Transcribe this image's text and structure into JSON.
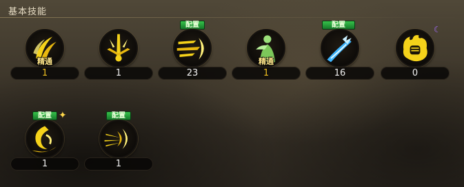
{
  "panel": {
    "title": "基本技能"
  },
  "skills": [
    {
      "icon": "golden-slash-icon",
      "level": "1",
      "level_color": "gold",
      "tag": "",
      "mastery": "精通"
    },
    {
      "icon": "golden-burst-icon",
      "level": "1",
      "level_color": "white",
      "tag": "",
      "mastery": ""
    },
    {
      "icon": "golden-rush-icon",
      "level": "23",
      "level_color": "white",
      "tag": "配置",
      "mastery": ""
    },
    {
      "icon": "green-figure-icon",
      "level": "1",
      "level_color": "gold",
      "tag": "",
      "mastery": "精通"
    },
    {
      "icon": "blue-lightning-strike-icon",
      "level": "16",
      "level_color": "white",
      "tag": "配置",
      "mastery": ""
    },
    {
      "icon": "golden-fire-fist-icon",
      "level": "0",
      "level_color": "white",
      "tag": "",
      "mastery": ""
    },
    {
      "icon": "golden-whirlwind-icon",
      "level": "1",
      "level_color": "white",
      "tag": "配置",
      "mastery": ""
    },
    {
      "icon": "golden-arrow-dash-icon",
      "level": "1",
      "level_color": "white",
      "tag": "配置",
      "mastery": ""
    }
  ]
}
